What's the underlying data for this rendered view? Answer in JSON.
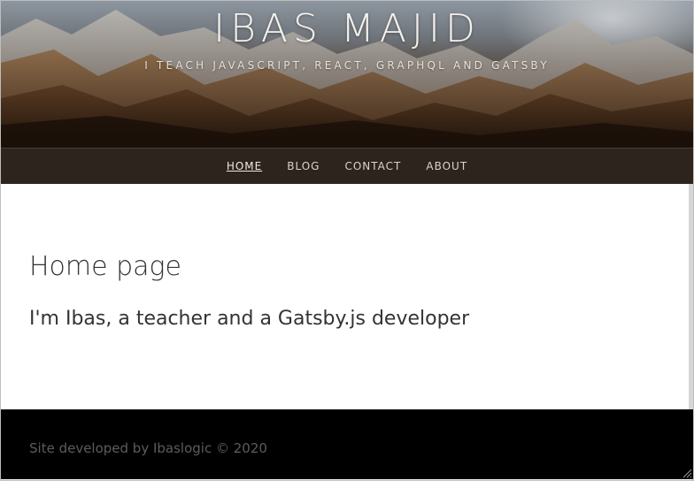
{
  "site": {
    "title": "IBAS MAJID",
    "subtitle": "I TEACH JAVASCRIPT, REACT, GRAPHQL AND GATSBY"
  },
  "nav": {
    "items": [
      {
        "label": "HOME",
        "active": true
      },
      {
        "label": "BLOG",
        "active": false
      },
      {
        "label": "CONTACT",
        "active": false
      },
      {
        "label": "ABOUT",
        "active": false
      }
    ]
  },
  "main": {
    "heading": "Home page",
    "intro": "I'm Ibas, a teacher and a Gatsby.js developer"
  },
  "footer": {
    "credit": "Site developed by Ibaslogic © 2020"
  },
  "colors": {
    "nav_bg": "#2d241e",
    "footer_bg": "#000000",
    "text_dark": "#333333",
    "footer_text": "#5c5c5c"
  },
  "icons": {
    "resize": "resize-grip-icon"
  }
}
